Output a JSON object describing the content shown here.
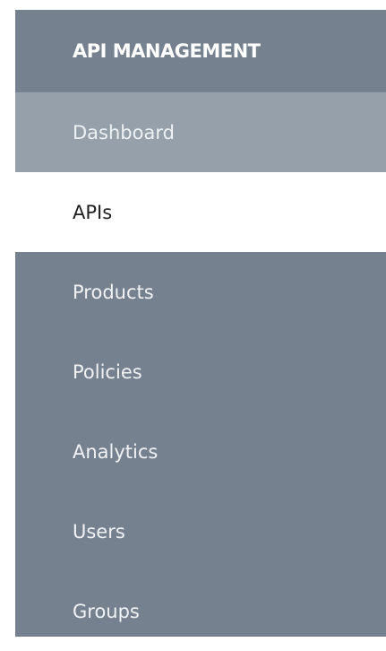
{
  "nav": {
    "title": "API MANAGEMENT",
    "items": [
      {
        "label": "Dashboard",
        "state": "hover"
      },
      {
        "label": "APIs",
        "state": "active"
      },
      {
        "label": "Products",
        "state": "normal"
      },
      {
        "label": "Policies",
        "state": "normal"
      },
      {
        "label": "Analytics",
        "state": "normal"
      },
      {
        "label": "Users",
        "state": "normal"
      },
      {
        "label": "Groups",
        "state": "normal"
      }
    ]
  },
  "colors": {
    "nav_background": "#75818f",
    "hover_background": "#95a0ab",
    "active_background": "#ffffff",
    "active_text": "#1f1f1f",
    "text": "#ffffff"
  }
}
